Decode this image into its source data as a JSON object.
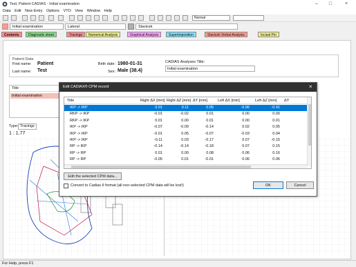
{
  "window": {
    "title": "Test, Patient CADIAS - Initial examination"
  },
  "menu": [
    "Data",
    "Edit",
    "New Entry",
    "Options",
    "VTO",
    "View",
    "Window",
    "Help"
  ],
  "toolbar": {
    "combo_value": "Normal"
  },
  "selectors": {
    "exam": "Initial examination",
    "view": "Lateral",
    "analysis": "Slavicek"
  },
  "tabs": [
    "Contents",
    "Diagnostic sheet",
    "Tracings",
    "Numerical Analysis",
    "Graphical Analysis",
    "Superimposition",
    "Slavicek Verbal Analysis",
    "Incisal Pin"
  ],
  "tab_colors": [
    "#ff8c8c",
    "#80e080",
    "#ff8c8c",
    "#f0f080",
    "#ffa0ff",
    "#80e0ff",
    "#ff9a8c",
    "#f0f090"
  ],
  "patient": {
    "section_label": "Patient Data",
    "first_label": "First name:",
    "first_value": "Patient",
    "last_label": "Last name:",
    "last_value": "Test",
    "birth_label": "Birth date:",
    "birth_value": "1980-01-31",
    "sex_label": "Sex:",
    "sex_value": "Male (38.4)",
    "analyses_label": "CADIAS Analyses Title:",
    "analyses_value": "Initial examination"
  },
  "left_panel": {
    "title_header": "Title",
    "title_row": "Initial examination",
    "type_label": "Type:",
    "type_value": "Tracings",
    "ratio": "1 : 1.77"
  },
  "dialog": {
    "title": "Edit CADIAX® CPM record",
    "columns": [
      "Title",
      "Right ΔX [mm]",
      "Right ΔZ [mm]",
      "ΔY [mm]",
      "Left ΔX [mm]",
      "Left ΔZ [mm]",
      "ΔY"
    ],
    "rows": [
      [
        "IKP -> IKP",
        "0.01",
        "0.11",
        "0.05",
        "-0.06",
        "-0.41",
        ""
      ],
      [
        "RKP -> IKP",
        "-0.01",
        "-0.02",
        "0.01",
        "0.00",
        "0.00",
        ""
      ],
      [
        "RKP -> IKP",
        "0.01",
        "0.00",
        "0.01",
        "0.00",
        "0.01",
        ""
      ],
      [
        "IKP -> IKP",
        "-0.07",
        "-0.09",
        "-0.14",
        "0.02",
        "0.05",
        ""
      ],
      [
        "IKP -> IKP",
        "-0.01",
        "0.05",
        "-0.07",
        "-0.03",
        "0.04",
        ""
      ],
      [
        "IKP -> IKP",
        "-0.11",
        "0.03",
        "-0.17",
        "0.07",
        "-0.15",
        ""
      ],
      [
        "RP -> IKP",
        "-0.14",
        "-0.14",
        "-0.18",
        "0.07",
        "0.15",
        ""
      ],
      [
        "RP -> RP",
        "0.01",
        "0.00",
        "0.08",
        "0.06",
        "0.16",
        ""
      ],
      [
        "RP -> RP",
        "-0.05",
        "0.01",
        "-0.01",
        "0.06",
        "0.06",
        ""
      ]
    ],
    "edit_button": "Edit the selected CPM data...",
    "convert_label": "Convert to Cadias II format (all non-selected CPM data will be lost!)",
    "ok_button": "OK",
    "cancel_button": "Cancel",
    "selected_row": 0
  },
  "status": {
    "text": "For Help, press F1"
  },
  "colors": {
    "selection": "#0078d7",
    "dialog_title": "#313131"
  }
}
